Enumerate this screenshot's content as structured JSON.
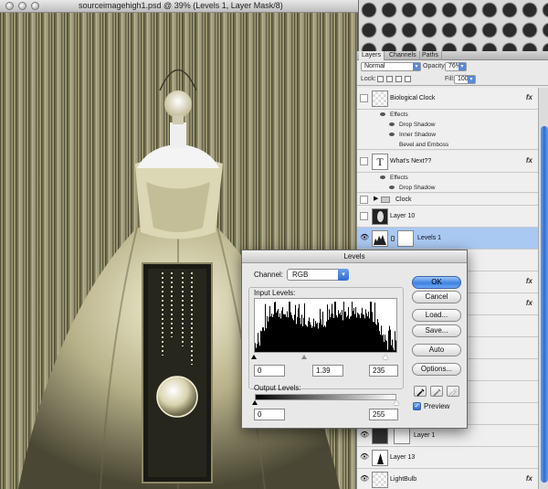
{
  "document": {
    "title": "sourceimagehigh1.psd @ 39% (Levels 1, Layer Mask/8)"
  },
  "layers_panel": {
    "tabs": [
      "Layers",
      "Channels",
      "Paths"
    ],
    "blend_mode": "Normal",
    "opacity_label": "Opacity:",
    "opacity_value": "76%",
    "lock_label": "Lock:",
    "fill_label": "Fill:",
    "fill_value": "100%",
    "fx_label": "fx",
    "layers": [
      {
        "name": "Biological Clock",
        "thumb_type": "checker",
        "fx": true
      },
      {
        "name": "What's                Next??",
        "thumb_type": "text",
        "fx": true
      },
      {
        "name": "Clock",
        "thumb_type": "folder",
        "fx": false
      },
      {
        "name": "Layer 10",
        "thumb_type": "oval",
        "fx": false
      },
      {
        "name": "Levels 1",
        "thumb_type": "levels",
        "fx": false,
        "selected": true
      },
      {
        "name": "Layer 1",
        "thumb_type": "dark",
        "fx": false
      },
      {
        "name": "Layer 13",
        "thumb_type": "black",
        "fx": false
      },
      {
        "name": "LightBulb",
        "thumb_type": "checker",
        "fx": true
      }
    ],
    "effects_group_1": [
      "Effects",
      "Drop Shadow",
      "Inner Shadow",
      "Bevel and Emboss"
    ],
    "effects_group_2": [
      "Effects",
      "Drop Shadow"
    ],
    "text_thumb_glyph": "T"
  },
  "levels_dialog": {
    "title": "Levels",
    "channel_label": "Channel:",
    "channel_value": "RGB",
    "input_levels_label": "Input Levels:",
    "input_black": "0",
    "input_gamma": "1.39",
    "input_white": "235",
    "output_levels_label": "Output Levels:",
    "output_black": "0",
    "output_white": "255",
    "buttons": {
      "ok": "OK",
      "cancel": "Cancel",
      "load": "Load...",
      "save": "Save...",
      "auto": "Auto",
      "options": "Options..."
    },
    "preview_label": "Preview",
    "preview_checked": true,
    "checkmark": "✓",
    "dropdown_arrow": "▾"
  },
  "colors": {
    "selection_blue": "#a9c8f2",
    "aqua_blue": "#3f82e0",
    "sepia_light": "#e9e4b8",
    "sepia_dark": "#2a2a1e"
  }
}
